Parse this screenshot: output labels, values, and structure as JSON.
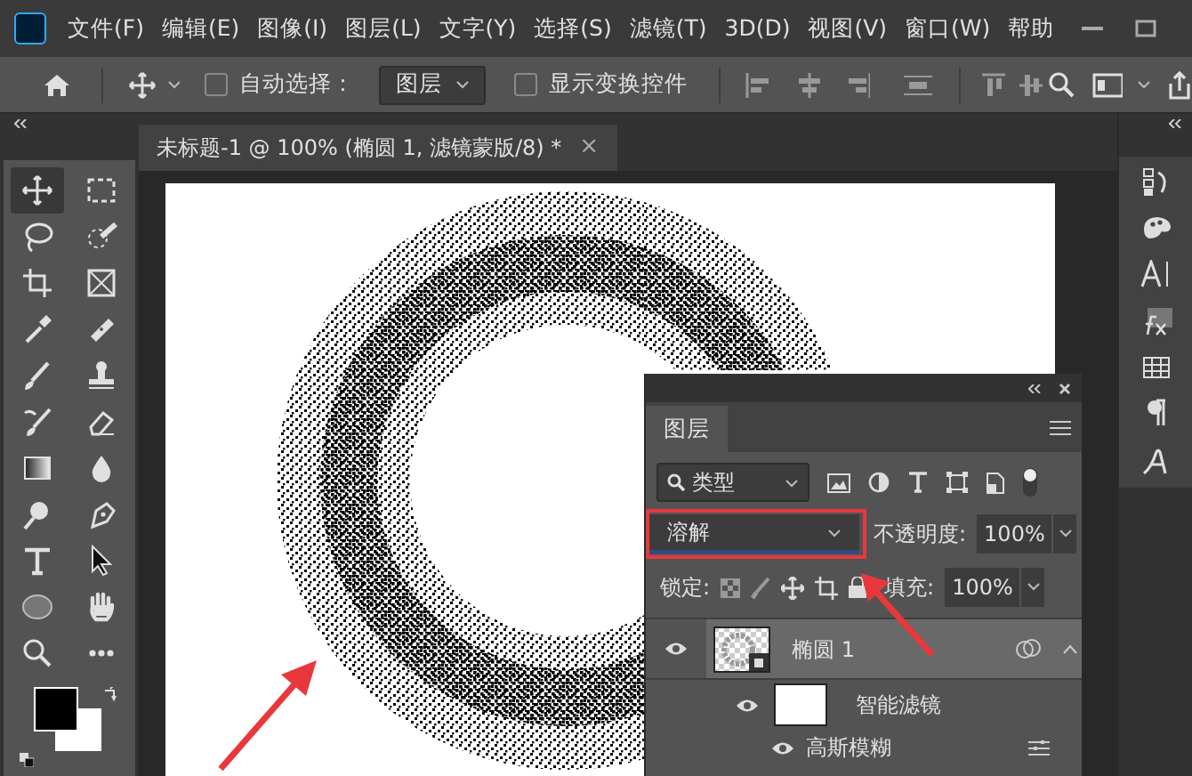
{
  "menu": {
    "items": [
      "文件(F)",
      "编辑(E)",
      "图像(I)",
      "图层(L)",
      "文字(Y)",
      "选择(S)",
      "滤镜(T)",
      "3D(D)",
      "视图(V)",
      "窗口(W)",
      "帮助"
    ]
  },
  "options_bar": {
    "auto_select": {
      "label": "自动选择：",
      "checked": false
    },
    "target": "图层",
    "show_transform": {
      "label": "显示变换控件",
      "checked": false
    }
  },
  "document_tab": {
    "title": "未标题-1 @ 100% (椭圆 1, 滤镜蒙版/8) *",
    "close": "×"
  },
  "tools": [
    {
      "kind": "move",
      "selected": true
    },
    {
      "kind": "marquee",
      "selected": false
    },
    {
      "kind": "lasso",
      "selected": false
    },
    {
      "kind": "quickselect",
      "selected": false
    },
    {
      "kind": "crop",
      "selected": false
    },
    {
      "kind": "frame",
      "selected": false
    },
    {
      "kind": "eyedropper",
      "selected": false
    },
    {
      "kind": "bandage",
      "selected": false
    },
    {
      "kind": "brush",
      "selected": false
    },
    {
      "kind": "stamp",
      "selected": false
    },
    {
      "kind": "historybrush",
      "selected": false
    },
    {
      "kind": "eraser",
      "selected": false
    },
    {
      "kind": "gradient",
      "selected": false
    },
    {
      "kind": "drop",
      "selected": false
    },
    {
      "kind": "dodge",
      "selected": false
    },
    {
      "kind": "pen",
      "selected": false
    },
    {
      "kind": "type",
      "selected": false
    },
    {
      "kind": "pointer",
      "selected": false
    },
    {
      "kind": "ellipse",
      "selected": false
    },
    {
      "kind": "hand",
      "selected": false
    },
    {
      "kind": "zoom",
      "selected": false
    },
    {
      "kind": "more",
      "selected": false
    }
  ],
  "layers_panel": {
    "tab": "图层",
    "filter": "类型",
    "blend_mode": "溶解",
    "opacity_label": "不透明度:",
    "opacity": "100%",
    "lock_label": "锁定:",
    "fill_label": "填充:",
    "fill": "100%",
    "layers": [
      {
        "name": "椭圆 1",
        "visible": true,
        "selected": true,
        "children": [
          {
            "name": "智能滤镜",
            "visible": true,
            "children": [
              {
                "name": "高斯模糊",
                "visible": true
              }
            ]
          }
        ]
      }
    ]
  }
}
